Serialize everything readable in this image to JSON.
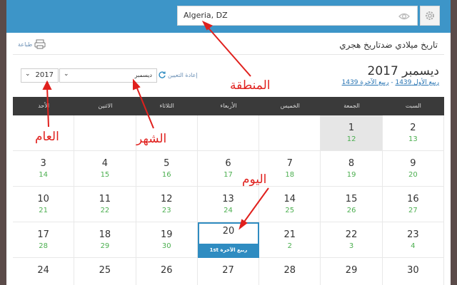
{
  "location": {
    "value": "Algeria, DZ"
  },
  "header": {
    "print_label": "طباعة",
    "title": "تاريخ ميلادي ضدتاريخ هجري"
  },
  "month": {
    "title": "ديسمبر 2017",
    "hijri_1": "ربيع الأول 1439",
    "hijri_sep": " - ",
    "hijri_2": "ربيع الآخرة 1439"
  },
  "controls": {
    "year": "2017",
    "month": "ديسمبر",
    "reset_label": "إعادة التعيين"
  },
  "weekdays": [
    "السبت",
    "الجمعة",
    "الخميس",
    "الأربعاء",
    "الثلاثاء",
    "الاثنين",
    "الأحد"
  ],
  "weeks": [
    [
      {
        "g": "2",
        "h": "13"
      },
      {
        "g": "1",
        "h": "12"
      },
      {
        "g": "",
        "h": ""
      },
      {
        "g": "",
        "h": ""
      },
      {
        "g": "",
        "h": ""
      },
      {
        "g": "",
        "h": ""
      },
      {
        "g": "",
        "h": ""
      }
    ],
    [
      {
        "g": "9",
        "h": "20"
      },
      {
        "g": "8",
        "h": "19"
      },
      {
        "g": "7",
        "h": "18"
      },
      {
        "g": "6",
        "h": "17"
      },
      {
        "g": "5",
        "h": "16"
      },
      {
        "g": "4",
        "h": "15"
      },
      {
        "g": "3",
        "h": "14"
      }
    ],
    [
      {
        "g": "16",
        "h": "27"
      },
      {
        "g": "15",
        "h": "26"
      },
      {
        "g": "14",
        "h": "25"
      },
      {
        "g": "13",
        "h": "24"
      },
      {
        "g": "12",
        "h": "23"
      },
      {
        "g": "11",
        "h": "22"
      },
      {
        "g": "10",
        "h": "21"
      }
    ],
    [
      {
        "g": "23",
        "h": "4"
      },
      {
        "g": "22",
        "h": "3"
      },
      {
        "g": "21",
        "h": "2"
      },
      {
        "g": "20",
        "h": "1st ربيع الآخرة"
      },
      {
        "g": "19",
        "h": "30"
      },
      {
        "g": "18",
        "h": "29"
      },
      {
        "g": "17",
        "h": "28"
      }
    ],
    [
      {
        "g": "30",
        "h": ""
      },
      {
        "g": "29",
        "h": ""
      },
      {
        "g": "28",
        "h": ""
      },
      {
        "g": "27",
        "h": ""
      },
      {
        "g": "26",
        "h": ""
      },
      {
        "g": "25",
        "h": ""
      },
      {
        "g": "24",
        "h": ""
      }
    ]
  ],
  "annotations": {
    "region": "المنطقة",
    "year": "العام",
    "month": "الشهر",
    "day": "اليوم"
  },
  "colors": {
    "topbar": "#3d95c8",
    "accent": "#2f8cc1",
    "hijri_green": "#4caf50",
    "annotation": "#e0201d"
  }
}
